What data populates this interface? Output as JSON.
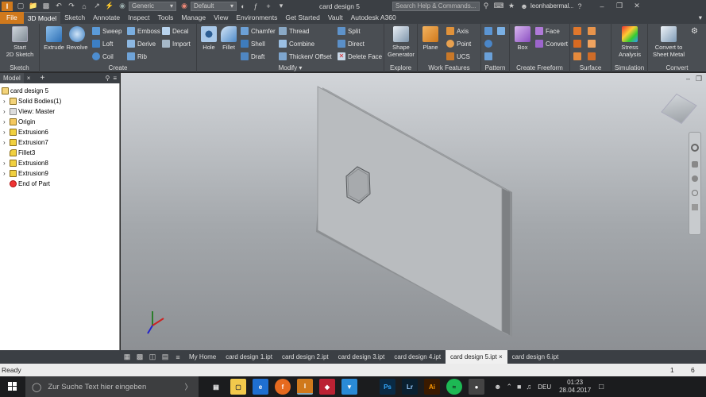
{
  "titlebar": {
    "material": "Generic",
    "appearance": "Default",
    "doc_title": "card design 5",
    "search_placeholder": "Search Help & Commands...",
    "user": "leonhabermal..."
  },
  "tabs": [
    "File",
    "3D Model",
    "Sketch",
    "Annotate",
    "Inspect",
    "Tools",
    "Manage",
    "View",
    "Environments",
    "Get Started",
    "Vault",
    "Autodesk A360"
  ],
  "ribbon": {
    "sketch": {
      "start_line1": "Start",
      "start_line2": "2D Sketch",
      "label": "Sketch"
    },
    "create": {
      "extrude": "Extrude",
      "revolve": "Revolve",
      "sweep": "Sweep",
      "emboss": "Emboss",
      "decal": "Decal",
      "loft": "Loft",
      "derive": "Derive",
      "import": "Import",
      "coil": "Coil",
      "rib": "Rib",
      "label": "Create"
    },
    "modify": {
      "hole": "Hole",
      "fillet": "Fillet",
      "chamfer": "Chamfer",
      "thread": "Thread",
      "shell": "Shell",
      "combine": "Combine",
      "draft": "Draft",
      "thicken": "Thicken/ Offset",
      "split": "Split",
      "direct": "Direct",
      "delete_face": "Delete Face",
      "label": "Modify"
    },
    "explore": {
      "shape_line1": "Shape",
      "shape_line2": "Generator",
      "label": "Explore"
    },
    "work": {
      "plane": "Plane",
      "axis": "Axis",
      "point": "Point",
      "ucs": "UCS",
      "label": "Work Features"
    },
    "pattern": {
      "label": "Pattern"
    },
    "freeform": {
      "box": "Box",
      "face": "Face",
      "convert": "Convert",
      "label": "Create Freeform"
    },
    "surface": {
      "label": "Surface"
    },
    "simulation": {
      "stress_line1": "Stress",
      "stress_line2": "Analysis",
      "label": "Simulation"
    },
    "convert": {
      "sheet_line1": "Convert to",
      "sheet_line2": "Sheet Metal",
      "label": "Convert"
    }
  },
  "browser": {
    "tab": "Model",
    "items": [
      "card design 5",
      "Solid Bodies(1)",
      "View: Master",
      "Origin",
      "Extrusion6",
      "Extrusion7",
      "Fillet3",
      "Extrusion8",
      "Extrusion9",
      "End of Part"
    ]
  },
  "doctabs": {
    "home": "My Home",
    "files": [
      "card design 1.ipt",
      "card design 2.ipt",
      "card design 3.ipt",
      "card design 4.ipt",
      "card design 5.ipt",
      "card design 6.ipt"
    ],
    "active_index": 4
  },
  "status": {
    "text": "Ready",
    "count1": "1",
    "count2": "6"
  },
  "taskbar": {
    "search_placeholder": "Zur Suche Text hier eingeben",
    "lang": "DEU",
    "time": "01:23",
    "date": "28.04.2017"
  },
  "colors": {
    "file_tab": "#d0791c",
    "ribbon": "#4a4e53",
    "viewport_top": "#d2d5d9"
  }
}
